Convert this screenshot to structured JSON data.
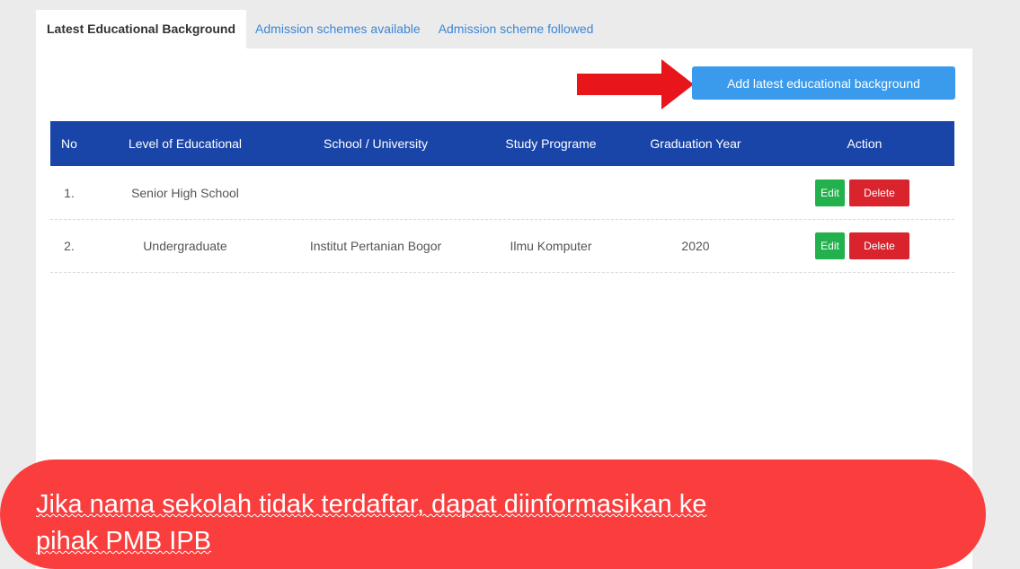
{
  "tabs": [
    {
      "label": "Latest Educational Background",
      "active": true
    },
    {
      "label": "Admission schemes available",
      "active": false
    },
    {
      "label": "Admission scheme followed",
      "active": false
    }
  ],
  "add_button_label": "Add latest educational background",
  "table": {
    "headers": {
      "no": "No",
      "level": "Level of Educational",
      "school": "School / University",
      "program": "Study Programe",
      "year": "Graduation Year",
      "action": "Action"
    },
    "rows": [
      {
        "no": "1.",
        "level": "Senior High School",
        "school": "",
        "program": "",
        "year": ""
      },
      {
        "no": "2.",
        "level": "Undergraduate",
        "school": "Institut Pertanian Bogor",
        "program": "Ilmu Komputer",
        "year": "2020"
      }
    ],
    "edit_label": "Edit",
    "delete_label": "Delete"
  },
  "banner": {
    "line1": "Jika nama sekolah tidak terdaftar, dapat diinformasikan ke",
    "line2": "pihak PMB IPB"
  },
  "colors": {
    "primary": "#3a9aeb",
    "table_header": "#1a45a8",
    "edit": "#22b14c",
    "delete": "#d9232d",
    "banner": "#fa3e3e",
    "arrow": "#e8161b"
  }
}
